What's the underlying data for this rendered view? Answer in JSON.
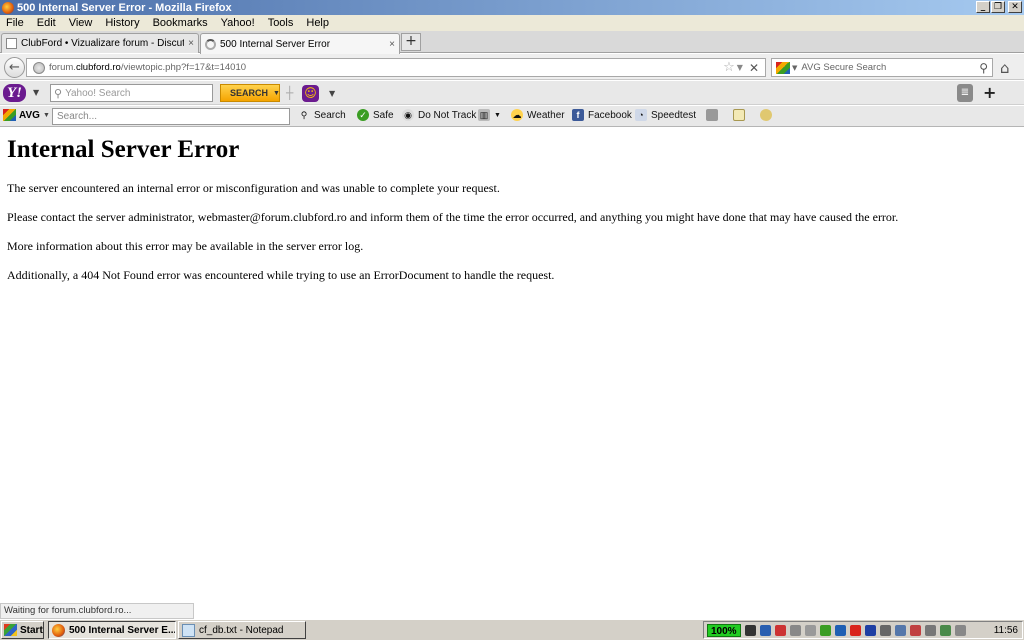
{
  "window": {
    "title": "500 Internal Server Error - Mozilla Firefox",
    "buttons": {
      "minimize": "_",
      "maximize": "❐",
      "close": "✕"
    }
  },
  "menu": [
    "File",
    "Edit",
    "View",
    "History",
    "Bookmarks",
    "Yahoo!",
    "Tools",
    "Help"
  ],
  "tabs": [
    {
      "label": "ClubFord • Vizualizare forum - Discutii libe...",
      "close": "×"
    },
    {
      "label": "500 Internal Server Error",
      "close": "×"
    }
  ],
  "newtab": "+",
  "nav": {
    "url_prefix": "forum.",
    "url_domain": "clubford.ro",
    "url_path": "/viewtopic.php?f=17&t=14010",
    "search_placeholder": "AVG Secure Search"
  },
  "yahoo_toolbar": {
    "logo": "Y!",
    "search_placeholder": "Yahoo! Search",
    "search_button": "SEARCH"
  },
  "avg_toolbar": {
    "logo": "AVG",
    "search_placeholder": "Search...",
    "buttons": [
      "Search",
      "Safe",
      "Do Not Track",
      "Weather",
      "Facebook",
      "Speedtest"
    ]
  },
  "page": {
    "heading": "Internal Server Error",
    "paragraphs": [
      "The server encountered an internal error or misconfiguration and was unable to complete your request.",
      "Please contact the server administrator, webmaster@forum.clubford.ro and inform them of the time the error occurred, and anything you might have done that may have caused the error.",
      "More information about this error may be available in the server error log.",
      "Additionally, a 404 Not Found error was encountered while trying to use an ErrorDocument to handle the request."
    ]
  },
  "status": "Waiting for forum.clubford.ro...",
  "taskbar": {
    "start": "Start",
    "items": [
      "500 Internal Server E...",
      "cf_db.txt - Notepad"
    ],
    "zoom": "100%",
    "clock": "11:56"
  },
  "colors": {
    "title_bar_start": "#4a6ea9",
    "yahoo_purple": "#6b1b8f",
    "yahoo_button": "#f5a400",
    "taskbar": "#d4d0c8"
  }
}
